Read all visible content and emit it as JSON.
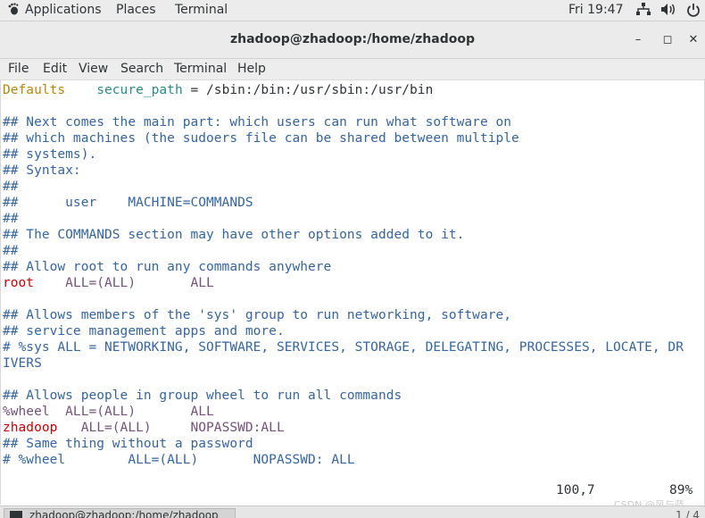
{
  "topbar": {
    "applications": "Applications",
    "places": "Places",
    "terminal": "Terminal",
    "clock": "Fri 19:47"
  },
  "window": {
    "title": "zhadoop@zhadoop:/home/zhadoop",
    "min": "–",
    "max": "◻",
    "close": "✕"
  },
  "menu": [
    "File",
    "Edit",
    "View",
    "Search",
    "Terminal",
    "Help"
  ],
  "lines": [
    [
      [
        "Defaults",
        "kd"
      ],
      [
        "    secure_path",
        "g"
      ],
      [
        " = /sbin:/bin:/usr/sbin:/usr/bin",
        "b"
      ]
    ],
    [],
    [
      [
        "## Next comes the main part: which users can run what software on",
        "c"
      ]
    ],
    [
      [
        "## which machines (the sudoers file can be shared between multiple",
        "c"
      ]
    ],
    [
      [
        "## systems).",
        "c"
      ]
    ],
    [
      [
        "## Syntax:",
        "c"
      ]
    ],
    [
      [
        "##",
        "c"
      ]
    ],
    [
      [
        "##      user    MACHINE=COMMANDS",
        "c"
      ]
    ],
    [
      [
        "##",
        "c"
      ]
    ],
    [
      [
        "## The COMMANDS section may have other options added to it.",
        "c"
      ]
    ],
    [
      [
        "##",
        "c"
      ]
    ],
    [
      [
        "## Allow root to run any commands anywhere",
        "c"
      ]
    ],
    [
      [
        "root",
        "r"
      ],
      [
        "    ALL=(ALL)",
        "p"
      ],
      [
        "       ALL",
        "p"
      ]
    ],
    [],
    [
      [
        "## Allows members of the 'sys' group to run networking, software,",
        "c"
      ]
    ],
    [
      [
        "## service management apps and more.",
        "c"
      ]
    ],
    [
      [
        "# %sys ALL = NETWORKING, SOFTWARE, SERVICES, STORAGE, DELEGATING, PROCESSES, LOCATE, DR",
        "c"
      ]
    ],
    [
      [
        "IVERS",
        "c"
      ]
    ],
    [],
    [
      [
        "## Allows people in group wheel to run all commands",
        "c"
      ]
    ],
    [
      [
        "%wheel",
        "p"
      ],
      [
        "  ALL=(ALL)",
        "p"
      ],
      [
        "       ALL",
        "p"
      ]
    ],
    [
      [
        "zhadoop",
        "r"
      ],
      [
        "   ALL=(ALL)",
        "p"
      ],
      [
        "     NOPASSWD:ALL",
        "p"
      ]
    ],
    [
      [
        "## Same thing without a password",
        "c"
      ]
    ],
    [
      [
        "# %wheel        ALL=(ALL)       NOPASSWD: ALL",
        "c"
      ]
    ]
  ],
  "status": {
    "position": "100,7",
    "percent": "89%"
  },
  "taskbar": {
    "task_label": "zhadoop@zhadoop:/home/zhadoop",
    "pager": "1 / 4"
  },
  "watermark": "CSDN @风与蓝",
  "icons": {
    "network": "network-icon",
    "volume": "volume-icon",
    "power": "power-icon"
  }
}
